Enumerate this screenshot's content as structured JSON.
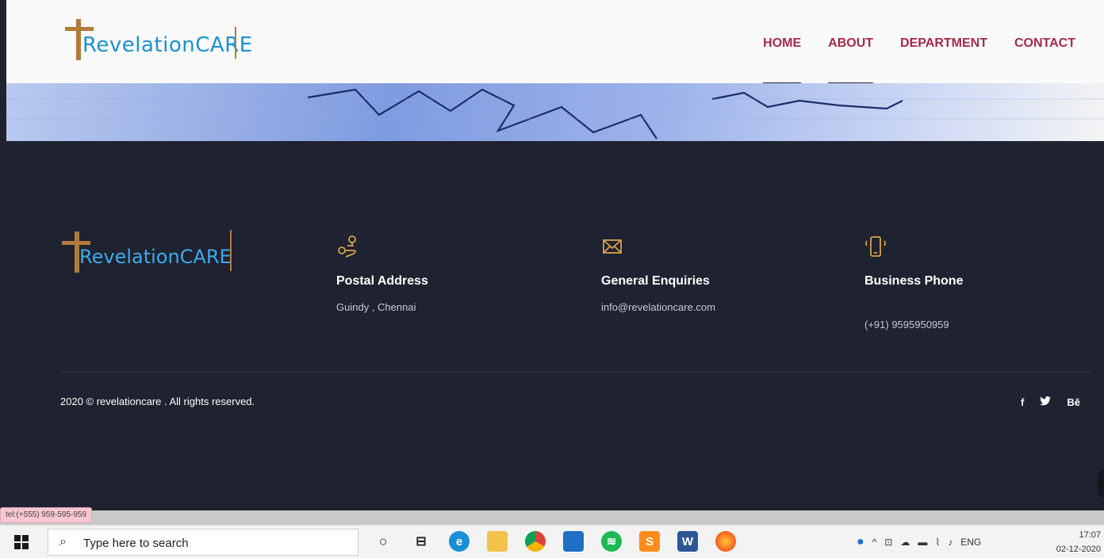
{
  "header": {
    "logo": {
      "prefix": "Revelation",
      "suffix": "CARE"
    },
    "nav": [
      {
        "label": "HOME",
        "active": true
      },
      {
        "label": "ABOUT",
        "active": true
      },
      {
        "label": "DEPARTMENT",
        "active": false
      },
      {
        "label": "CONTACT",
        "active": false
      }
    ]
  },
  "footer": {
    "logo": {
      "prefix": "Revelation",
      "suffix": "CARE"
    },
    "columns": [
      {
        "icon": "location-pin-icon",
        "title": "Postal Address",
        "value": "Guindy , Chennai"
      },
      {
        "icon": "envelope-icon",
        "title": "General Enquiries",
        "value": "info@revelationcare.com"
      },
      {
        "icon": "mobile-phone-icon",
        "title": "Business Phone",
        "value": "(+91) 9595950959"
      }
    ],
    "copyright": "2020 © revelationcare . All rights reserved.",
    "social": [
      {
        "icon": "facebook-icon",
        "label": "f"
      },
      {
        "icon": "twitter-icon",
        "label": "🐦"
      },
      {
        "icon": "behance-icon",
        "label": "Bē"
      }
    ]
  },
  "browser_status": {
    "url": "tel:(+555) 959-595-959"
  },
  "taskbar": {
    "search_placeholder": "Type here to search",
    "apps": [
      "cortana-icon",
      "task-view-icon",
      "edge-icon",
      "file-explorer-icon",
      "chrome-icon",
      "photos-icon",
      "spotify-icon",
      "sublime-text-icon",
      "word-icon",
      "firefox-icon"
    ],
    "language": "ENG",
    "time": "17:07",
    "date": "02-12-2020"
  },
  "colors": {
    "nav_text": "#a52a4a",
    "footer_bg": "#1f2230",
    "icon_accent": "#d9a24b",
    "logo_blue": "#1d8fd0",
    "logo_gold": "#b07c3a"
  }
}
